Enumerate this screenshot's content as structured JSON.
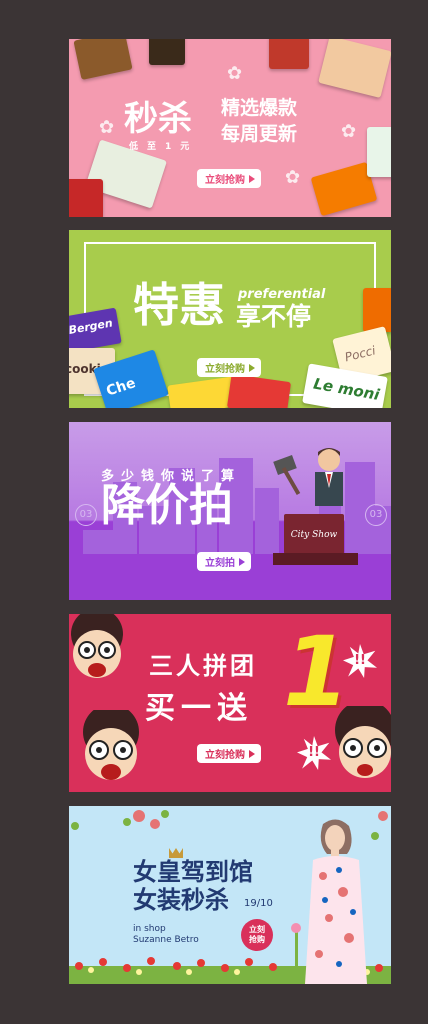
{
  "banners": {
    "b1": {
      "title_main": "秒杀",
      "title_line1": "精选爆款",
      "title_line2": "每周更新",
      "subtitle": "低至1元",
      "button": "立刻抢购"
    },
    "b2": {
      "title_main": "特惠",
      "title_en": "preferential",
      "title_sub": "享不停",
      "button": "立刻抢购",
      "package_labels": [
        "Bergen",
        "cookie",
        "Che",
        "Pocci",
        "Le moni"
      ]
    },
    "b3": {
      "title_top": "多少钱你说了算",
      "title_main": "降价拍",
      "button": "立刻拍",
      "side_label": "03",
      "podium_text": "City Show"
    },
    "b4": {
      "title_line1": "三人拼团",
      "title_line2": "买一送",
      "big_number": "1",
      "exclaim": "!!",
      "button": "立刻抢购"
    },
    "b5": {
      "title_line1": "女皇驾到馆",
      "title_line2": "女装秒杀",
      "date": "19/10",
      "shop_line1": "in shop",
      "shop_line2": "Suzanne Betro",
      "badge": "立刻抢购"
    }
  },
  "colors": {
    "background": "#3b3435",
    "pink": "#f49bb0",
    "green": "#a8cc4c",
    "purple": "#b77ae2",
    "red": "#d9305a",
    "sky": "#c3e6f7"
  }
}
